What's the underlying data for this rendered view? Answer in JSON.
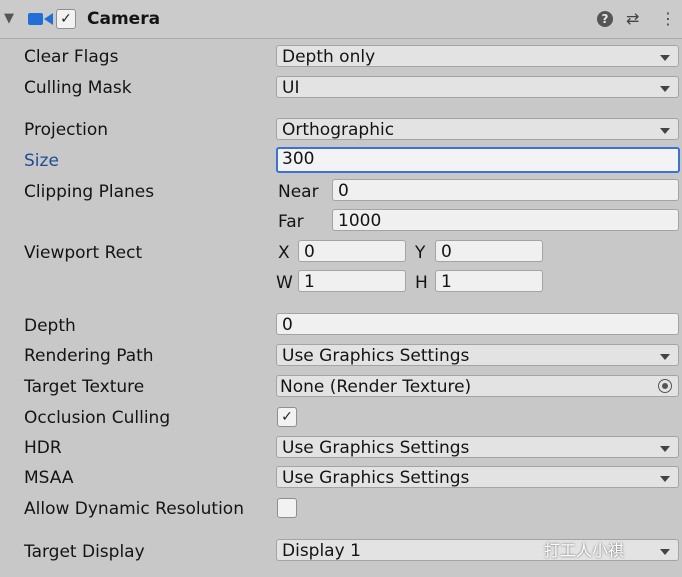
{
  "header": {
    "title": "Camera",
    "enabled": true,
    "icons": [
      "collapse-arrow-icon",
      "camera-icon",
      "help-icon",
      "preset-icon",
      "kebab-menu-icon"
    ]
  },
  "fields": {
    "clear_flags": {
      "label": "Clear Flags",
      "value": "Depth only"
    },
    "culling_mask": {
      "label": "Culling Mask",
      "value": "UI"
    },
    "projection": {
      "label": "Projection",
      "value": "Orthographic"
    },
    "size": {
      "label": "Size",
      "value": "300"
    },
    "clipping_planes": {
      "label": "Clipping Planes",
      "near_label": "Near",
      "near": "0",
      "far_label": "Far",
      "far": "1000"
    },
    "viewport_rect": {
      "label": "Viewport Rect",
      "x_label": "X",
      "x": "0",
      "y_label": "Y",
      "y": "0",
      "w_label": "W",
      "w": "1",
      "h_label": "H",
      "h": "1"
    },
    "depth": {
      "label": "Depth",
      "value": "0"
    },
    "rendering_path": {
      "label": "Rendering Path",
      "value": "Use Graphics Settings"
    },
    "target_texture": {
      "label": "Target Texture",
      "value": "None (Render Texture)"
    },
    "occlusion_culling": {
      "label": "Occlusion Culling",
      "checked": true
    },
    "hdr": {
      "label": "HDR",
      "value": "Use Graphics Settings"
    },
    "msaa": {
      "label": "MSAA",
      "value": "Use Graphics Settings"
    },
    "allow_dynamic_resolution": {
      "label": "Allow Dynamic Resolution",
      "checked": false
    },
    "target_display": {
      "label": "Target Display",
      "value": "Display 1"
    }
  },
  "watermark": {
    "text": "打工人小祺"
  },
  "colors": {
    "focus": "#3a72d6",
    "size_label": "#1f4c94",
    "background": "#c8c8c8"
  }
}
